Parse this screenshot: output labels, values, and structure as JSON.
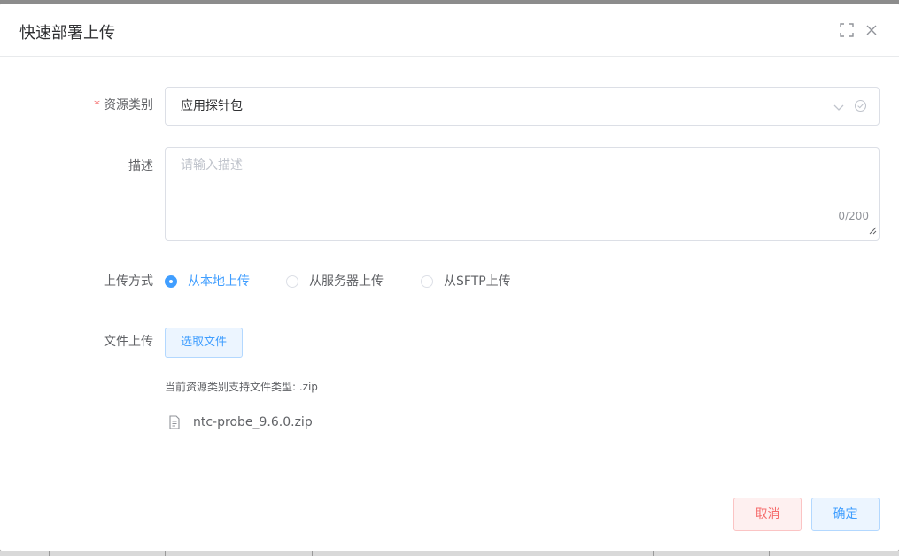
{
  "dialog": {
    "title": "快速部署上传"
  },
  "header_icons": {
    "maximize": "fullscreen-icon",
    "close": "close-icon"
  },
  "form": {
    "resource_type": {
      "label": "资源类别",
      "required_mark": "*",
      "value": "应用探针包"
    },
    "description": {
      "label": "描述",
      "placeholder": "请输入描述",
      "value": "",
      "counter": "0/200"
    },
    "upload_method": {
      "label": "上传方式",
      "options": [
        {
          "label": "从本地上传",
          "checked": true
        },
        {
          "label": "从服务器上传",
          "checked": false
        },
        {
          "label": "从SFTP上传",
          "checked": false
        }
      ]
    },
    "file_upload": {
      "label": "文件上传",
      "button_label": "选取文件",
      "tip": "当前资源类别支持文件类型: .zip",
      "files": [
        {
          "name": "ntc-probe_9.6.0.zip"
        }
      ]
    }
  },
  "footer": {
    "cancel_label": "取消",
    "confirm_label": "确定"
  },
  "colors": {
    "primary": "#409eff",
    "danger": "#f56c6c"
  }
}
